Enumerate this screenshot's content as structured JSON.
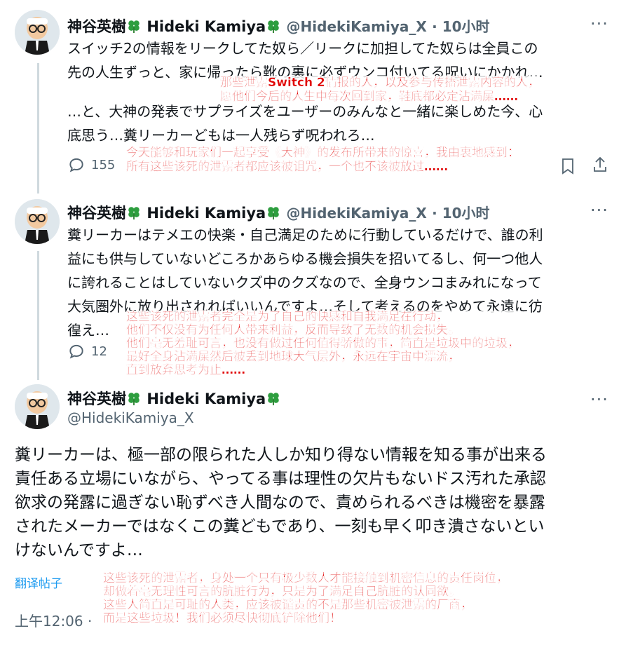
{
  "tweets": [
    {
      "display_name": "神谷英樹",
      "display_name2": "Hideki Kamiya",
      "handle": "@HidekiKamiya_X",
      "time": "· 10小时",
      "more": "···",
      "lines": [
        "スイッチ2の情報をリークしてた奴ら／リークに加担してた奴らは全員この",
        "先の人生ずっと、家に帰ったら靴の裏に必ずウンコ付いてる呪いにかかれ…",
        "…と、大神の発表でサプライズをユーザーのみんなと一緒に楽しめた今、心",
        "底思う…糞リーカーどもは一人残らず呪われろ…"
      ],
      "reply_count": "155",
      "overlay_top": [
        "那些泄露Switch 2情报的人，以及参与传播泄露内容的人，",
        "愿他们今后的人生中每次回到家，鞋底都必定沾满屎……"
      ],
      "overlay_bottom": [
        "今天能够和玩家们一起享受《大神》的发布所带来的惊喜，我由衷地感到：",
        "所有这些该死的泄露者都应该被诅咒，一个也不该被放过……"
      ]
    },
    {
      "display_name": "神谷英樹",
      "display_name2": "Hideki Kamiya",
      "handle": "@HidekiKamiya_X",
      "time": "· 10小时",
      "more": "···",
      "lines": [
        "糞リーカーはテメエの快楽・自己満足のために行動しているだけで、誰の利",
        "益にも供与していないどころかあらゆる機会損失を招いてるし、何一つ他人",
        "に誇れることはしていないクズ中のクズなので、全身ウンコまみれになって",
        "大気圏外に放り出されればいいんですよ…そして考えるのをやめて永遠に彷",
        "徨え…"
      ],
      "reply_count": "12",
      "overlay": [
        "这些该死的泄露者完全是为了自己的快感和自我满足在行动，",
        "他们不仅没有为任何人带来利益，反而导致了无数的机会损失。",
        "他们毫无羞耻可言，也没有做过任何值得骄傲的事，简直是垃圾中的垃圾，",
        "最好全身沾满屎然后被丢到地球大气层外，永远在宇宙中漂流，",
        "直到放弃思考为止……"
      ]
    },
    {
      "display_name": "神谷英樹",
      "display_name2": "Hideki Kamiya",
      "handle": "@HidekiKamiya_X",
      "more": "···",
      "lines": [
        "糞リーカーは、極一部の限られた人しか知り得ない情報を知る事が出来る",
        "責任ある立場にいながら、やってる事は理性の欠片もないドス汚れた承認",
        "欲求の発露に過ぎない恥ずべき人間なので、責められるべきは機密を暴露",
        "されたメーカーではなくこの糞どもであり、一刻も早く叩き潰さないとい",
        "けないんですよ…"
      ],
      "translate": "翻译帖子",
      "timestamp": "上午12:06 ·",
      "overlay": [
        "这些该死的泄露者，身处一个只有极少数人才能接触到机密信息的责任岗位，",
        "却做着毫无理性可言的肮脏行为，只是为了满足自己肮脏的认同欲。",
        "这些人简直是可耻的人类，应该被谴责的不是那些机密被泄露的厂商，",
        "而是这些垃圾！我们必须尽快彻底铲除他们！"
      ]
    }
  ],
  "colors": {
    "accent": "#1d9bf0",
    "overlay_red": "#e00000",
    "muted": "#536471",
    "clover": "#2e9e3f"
  },
  "icons": [
    "avatar",
    "clover-icon",
    "more-icon",
    "reply-icon",
    "bookmark-icon",
    "share-icon"
  ]
}
